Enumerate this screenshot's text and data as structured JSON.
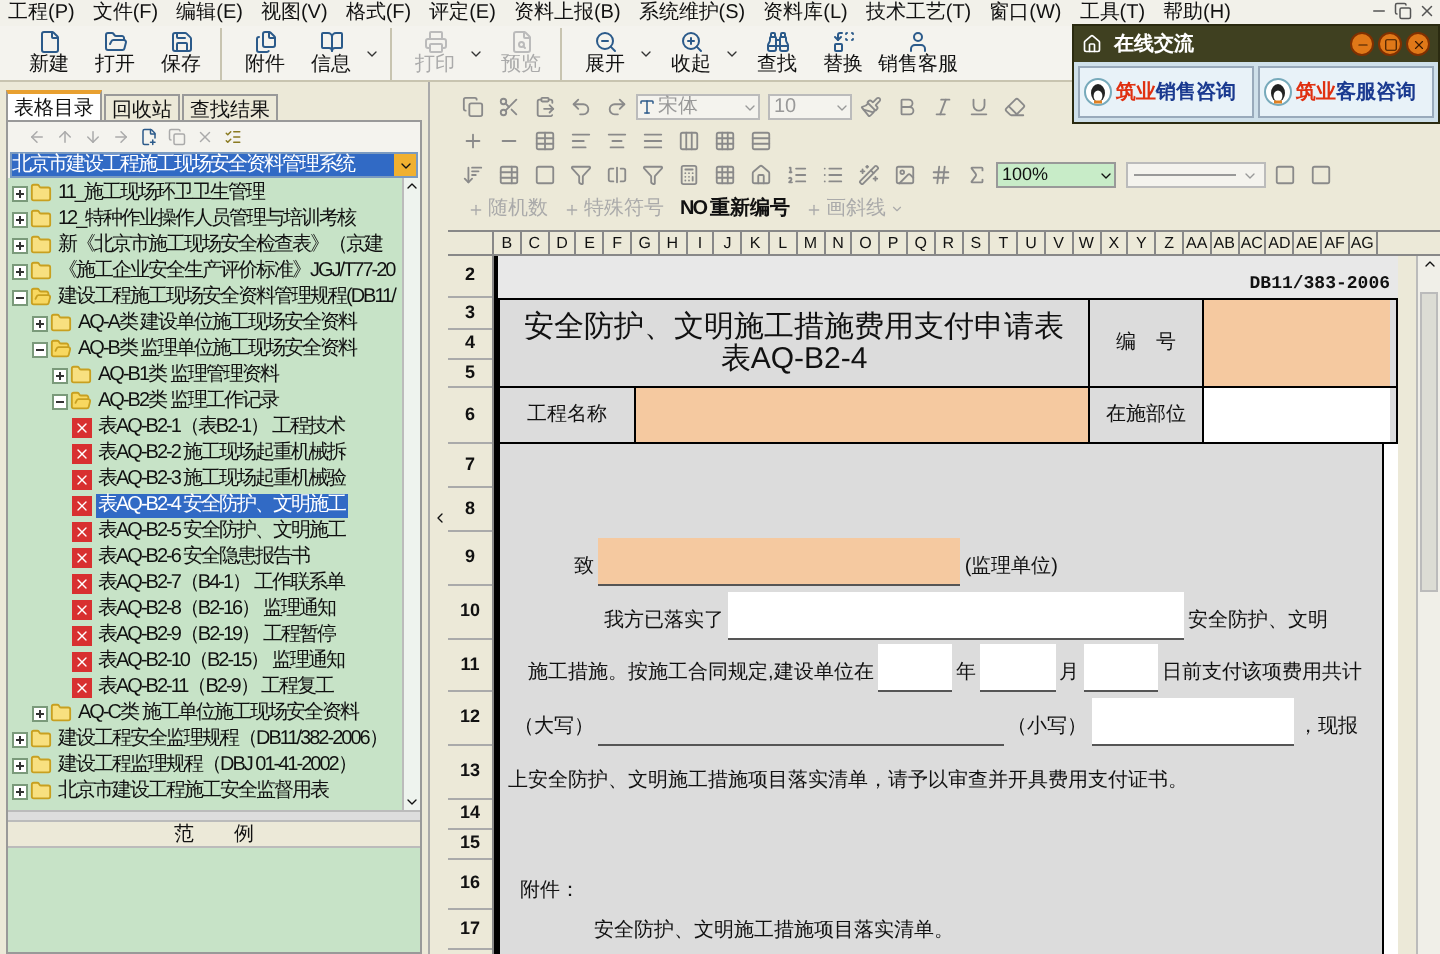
{
  "menu": [
    "工程(P)",
    "文件(F)",
    "编辑(E)",
    "视图(V)",
    "格式(F)",
    "评定(E)",
    "资料上报(B)",
    "系统维护(S)",
    "资料库(L)",
    "技术工艺(T)",
    "窗口(W)",
    "工具(T)",
    "帮助(H)"
  ],
  "toolbar": [
    {
      "label": "新建",
      "disabled": false,
      "dropdown": false
    },
    {
      "label": "打开",
      "disabled": false,
      "dropdown": false
    },
    {
      "label": "保存",
      "disabled": false,
      "dropdown": false
    },
    {
      "label": "附件",
      "disabled": false,
      "dropdown": false
    },
    {
      "label": "信息",
      "disabled": false,
      "dropdown": true
    },
    {
      "label": "打印",
      "disabled": true,
      "dropdown": true
    },
    {
      "label": "预览",
      "disabled": true,
      "dropdown": false
    },
    {
      "label": "展开",
      "disabled": false,
      "dropdown": true
    },
    {
      "label": "收起",
      "disabled": false,
      "dropdown": true
    },
    {
      "label": "查找",
      "disabled": false,
      "dropdown": false
    },
    {
      "label": "替换",
      "disabled": false,
      "dropdown": false
    },
    {
      "label": "销售客服",
      "disabled": false,
      "dropdown": false
    }
  ],
  "chat": {
    "title": "在线交流",
    "buttons": [
      {
        "brand": "筑业",
        "label": "销售咨询"
      },
      {
        "brand": "筑业",
        "label": "客服咨询"
      }
    ]
  },
  "left_panel": {
    "tabs": [
      {
        "label": "表格目录",
        "selected": true
      },
      {
        "label": "回收站",
        "selected": false
      },
      {
        "label": "查找结果",
        "selected": false
      }
    ],
    "system_select": {
      "value": "北京市建设工程施工现场安全资料管理系统"
    },
    "tree": [
      {
        "kind": "folder",
        "label": "11_施工现场环卫卫生管理",
        "expanded": false,
        "selected": false
      },
      {
        "kind": "folder",
        "label": "12_特种作业操作人员管理与培训考核",
        "expanded": false,
        "selected": false
      },
      {
        "kind": "folder",
        "label": "新《北京市施工现场安全检查表》（京建",
        "expanded": false,
        "selected": false
      },
      {
        "kind": "folder",
        "label": "《施工企业安全生产评价标准》JGJ/T77-20",
        "expanded": false,
        "selected": false
      },
      {
        "kind": "folder",
        "label": "建设工程施工现场安全资料管理规程(DB11/",
        "expanded": true,
        "selected": false,
        "children": [
          {
            "kind": "folder",
            "label": "AQ-A类 建设单位施工现场安全资料",
            "expanded": false,
            "selected": false
          },
          {
            "kind": "folder",
            "label": "AQ-B类 监理单位施工现场安全资料",
            "expanded": true,
            "selected": false,
            "children": [
              {
                "kind": "folder",
                "label": "AQ-B1类 监理管理资料",
                "expanded": false,
                "selected": false
              },
              {
                "kind": "folder",
                "label": "AQ-B2类 监理工作记录",
                "expanded": true,
                "selected": false,
                "children": [
                  {
                    "kind": "doc",
                    "label": "表AQ-B2-1（表B2-1） 工程技术",
                    "selected": false
                  },
                  {
                    "kind": "doc",
                    "label": "表AQ-B2-2 施工现场起重机械拆",
                    "selected": false
                  },
                  {
                    "kind": "doc",
                    "label": "表AQ-B2-3 施工现场起重机械验",
                    "selected": false
                  },
                  {
                    "kind": "doc",
                    "label": "表AQ-B2-4 安全防护、文明施工",
                    "selected": true
                  },
                  {
                    "kind": "doc",
                    "label": "表AQ-B2-5 安全防护、文明施工",
                    "selected": false
                  },
                  {
                    "kind": "doc",
                    "label": "表AQ-B2-6 安全隐患报告书",
                    "selected": false
                  },
                  {
                    "kind": "doc",
                    "label": "表AQ-B2-7（B4-1） 工作联系单",
                    "selected": false
                  },
                  {
                    "kind": "doc",
                    "label": "表AQ-B2-8（B2-16） 监理通知",
                    "selected": false
                  },
                  {
                    "kind": "doc",
                    "label": "表AQ-B2-9（B2-19） 工程暂停",
                    "selected": false
                  },
                  {
                    "kind": "doc",
                    "label": "表AQ-B2-10（B2-15） 监理通知",
                    "selected": false
                  },
                  {
                    "kind": "doc",
                    "label": "表AQ-B2-11（B2-9） 工程复工",
                    "selected": false
                  }
                ]
              }
            ]
          },
          {
            "kind": "folder",
            "label": "AQ-C类 施工单位施工现场安全资料",
            "expanded": false,
            "selected": false
          }
        ]
      },
      {
        "kind": "folder",
        "label": "建设工程安全监理规程（DB11/382-2006）",
        "expanded": false,
        "selected": false
      },
      {
        "kind": "folder",
        "label": "建设工程监理规程（DBJ 01-41-2002）",
        "expanded": false,
        "selected": false
      },
      {
        "kind": "folder",
        "label": "北京市建设工程施工安全监督用表",
        "expanded": false,
        "selected": false
      }
    ],
    "example_header": "范　　例"
  },
  "format_toolbar": {
    "font": "宋体",
    "size": "10",
    "zoom": "100%",
    "tools": [
      {
        "label": "随机数",
        "disabled": true,
        "dropdown": false
      },
      {
        "label": "特殊符号",
        "disabled": true,
        "dropdown": false
      },
      {
        "label": "重新编号",
        "badge": "NO",
        "disabled": false,
        "dropdown": false
      },
      {
        "label": "画斜线",
        "disabled": true,
        "dropdown": true
      }
    ]
  },
  "sheet": {
    "columns": [
      "B",
      "C",
      "D",
      "E",
      "F",
      "G",
      "H",
      "I",
      "J",
      "K",
      "L",
      "M",
      "N",
      "O",
      "P",
      "Q",
      "R",
      "S",
      "T",
      "U",
      "V",
      "W",
      "X",
      "Y",
      "Z",
      "AA",
      "AB",
      "AC",
      "AD",
      "AE",
      "AF",
      "AG"
    ],
    "rows": [
      "2",
      "3",
      "4",
      "5",
      "6",
      "7",
      "8",
      "9",
      "10",
      "11",
      "12",
      "13",
      "14",
      "15",
      "16",
      "17"
    ],
    "form": {
      "standard": "DB11/383-2006",
      "title": "安全防护、文明施工措施费用支付申请表",
      "subtitle": "表AQ-B2-4",
      "number_label": "编　号",
      "project_label": "工程名称",
      "location_label": "在施部位",
      "body": [
        {
          "segments": [
            {
              "kind": "text",
              "text": "致"
            },
            {
              "kind": "field",
              "highlighted": true
            },
            {
              "kind": "text",
              "text": "(监理单位)"
            }
          ]
        },
        {
          "segments": [
            {
              "kind": "text",
              "text": "我方已落实了"
            },
            {
              "kind": "field",
              "highlighted": false
            },
            {
              "kind": "text",
              "text": "安全防护、文明"
            }
          ]
        },
        {
          "segments": [
            {
              "kind": "text",
              "text": "施工措施。按施工合同规定,建设单位在"
            },
            {
              "kind": "field",
              "highlighted": false
            },
            {
              "kind": "text",
              "text": "年"
            },
            {
              "kind": "field",
              "highlighted": false
            },
            {
              "kind": "text",
              "text": "月"
            },
            {
              "kind": "field",
              "highlighted": false
            },
            {
              "kind": "text",
              "text": "日前支付该项费用共计"
            }
          ]
        },
        {
          "segments": [
            {
              "kind": "text",
              "text": "（大写）"
            },
            {
              "kind": "line"
            },
            {
              "kind": "text",
              "text": "（小写）"
            },
            {
              "kind": "field",
              "highlighted": false
            },
            {
              "kind": "text",
              "text": "，现报"
            }
          ]
        },
        {
          "segments": [
            {
              "kind": "text",
              "text": "上安全防护、文明施工措施项目落实清单，请予以审查并开具费用支付证书。"
            }
          ]
        },
        {
          "segments": [
            {
              "kind": "text",
              "text": "附件："
            }
          ]
        },
        {
          "segments": [
            {
              "kind": "text",
              "text": "安全防护、文明施工措施项目落实清单。"
            }
          ]
        }
      ]
    }
  }
}
